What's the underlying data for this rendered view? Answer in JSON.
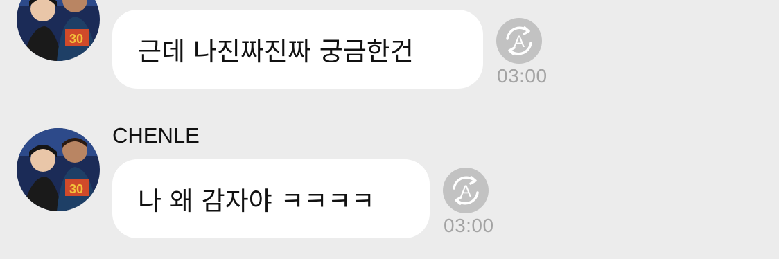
{
  "messages": [
    {
      "sender": "",
      "text": "근데 나진짜진짜 궁금한건",
      "time": "03:00"
    },
    {
      "sender": "CHENLE",
      "text": "나 왜 감자야 ㅋㅋㅋㅋ",
      "time": "03:00"
    }
  ],
  "icons": {
    "translate": "translate-icon"
  },
  "colors": {
    "background": "#ececec",
    "bubble": "#ffffff",
    "timestamp": "#a3a3a3",
    "translate_icon": "#c2c2c2"
  }
}
